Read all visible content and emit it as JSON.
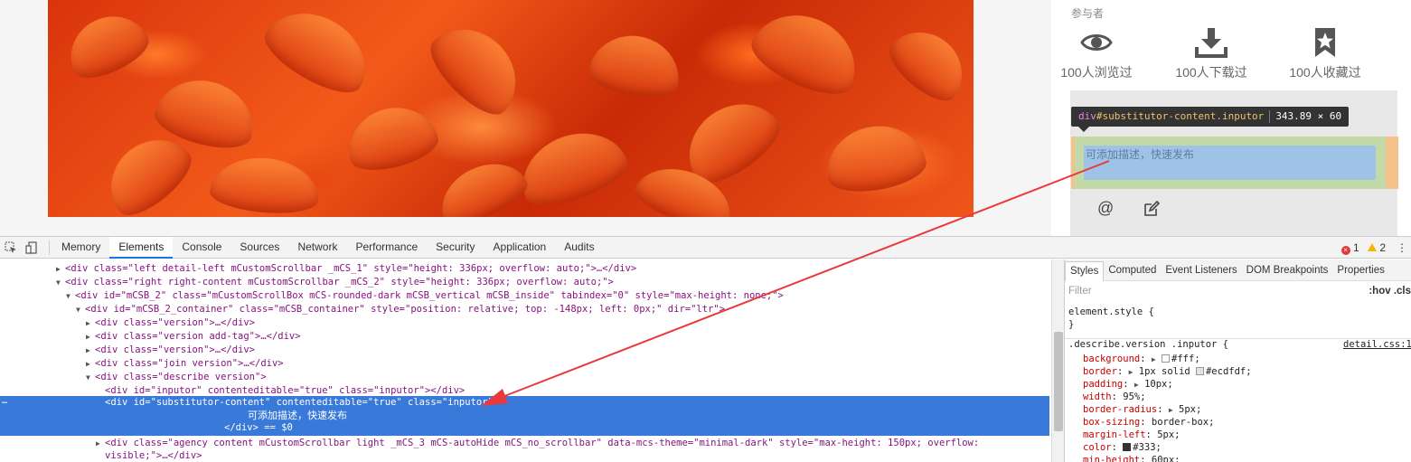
{
  "page": {
    "participants_title": "参与者",
    "stats": [
      {
        "icon": "eye-icon",
        "text": "100人浏览过"
      },
      {
        "icon": "download-icon",
        "text": "100人下载过"
      },
      {
        "icon": "star-bookmark-icon",
        "text": "100人收藏过"
      }
    ],
    "inspect_tooltip": {
      "tag": "div",
      "id_class": "#substitutor-content.inputor",
      "size": "343.89 × 60"
    },
    "placeholder_text": "可添加描述，快速发布",
    "bottom_icons": {
      "at": "@",
      "edit": "edit-icon"
    }
  },
  "devtools": {
    "tabs": [
      "Memory",
      "Elements",
      "Console",
      "Sources",
      "Network",
      "Performance",
      "Security",
      "Application",
      "Audits"
    ],
    "active_tab": "Elements",
    "errors": "1",
    "warnings": "2",
    "dom_lines": [
      {
        "tri": "▶",
        "text": "<div class=\"left detail-left  mCustomScrollbar _mCS_1\" style=\"height: 336px; overflow: auto;\">…</div>"
      },
      {
        "tri": "▼",
        "text": "<div class=\"right right-content mCustomScrollbar _mCS_2\" style=\"height: 336px; overflow: auto;\">"
      },
      {
        "tri": "▼",
        "text": "<div id=\"mCSB_2\" class=\"mCustomScrollBox mCS-rounded-dark mCSB_vertical mCSB_inside\" tabindex=\"0\" style=\"max-height: none;\">"
      },
      {
        "tri": "▼",
        "text": "<div id=\"mCSB_2_container\" class=\"mCSB_container\" style=\"position: relative; top: -148px; left: 0px;\" dir=\"ltr\">"
      },
      {
        "tri": "▶",
        "text": "<div class=\"version\">…</div>"
      },
      {
        "tri": "▶",
        "text": "<div class=\"version add-tag\">…</div>"
      },
      {
        "tri": "▶",
        "text": "<div class=\"version\">…</div>"
      },
      {
        "tri": "▶",
        "text": "<div class=\"join version\">…</div>"
      },
      {
        "tri": "▼",
        "text": "<div class=\"describe version\">"
      },
      {
        "tri": "",
        "text": "<div id=\"inputor\" contenteditable=\"true\" class=\"inputor\"></div>"
      }
    ],
    "selected_lines": [
      "<div id=\"substitutor-content\" contenteditable=\"true\" class=\"inputor\">",
      "可添加描述，快速发布",
      "</div> == $0"
    ],
    "after_lines": [
      {
        "tri": "▶",
        "text": "<div class=\"agency content mCustomScrollbar light _mCS_3 mCS-autoHide mCS_no_scrollbar\" data-mcs-theme=\"minimal-dark\" style=\"max-height: 150px; overflow:"
      },
      {
        "tri": "",
        "text": "visible;\">…</div>"
      }
    ],
    "styles_tabs": [
      "Styles",
      "Computed",
      "Event Listeners",
      "DOM Breakpoints",
      "Properties"
    ],
    "filter_placeholder": "Filter",
    "filter_right": ":hov  .cls",
    "element_style": "element.style {",
    "element_style_close": "}",
    "rule_selector": ".describe.version .inputor {",
    "rule_source": "detail.css:1",
    "rule_props": [
      {
        "name": "background",
        "value": "#fff;",
        "swatch": "#ffffff",
        "arrow": true
      },
      {
        "name": "border",
        "value": "1px solid",
        "value2": "#ecdfdf;",
        "swatch": "#ecdfdf",
        "arrow": true
      },
      {
        "name": "padding",
        "value": "10px;",
        "arrow": true
      },
      {
        "name": "width",
        "value": "95%;"
      },
      {
        "name": "border-radius",
        "value": "5px;",
        "arrow": true
      },
      {
        "name": "box-sizing",
        "value": "border-box;"
      },
      {
        "name": "margin-left",
        "value": "5px;"
      },
      {
        "name": "color",
        "value": "#333;",
        "swatch": "#333333"
      },
      {
        "name": "min-height",
        "value": "60px;"
      }
    ]
  },
  "colors": {
    "selection": "#3879d9",
    "arrow": "#e8393c"
  }
}
